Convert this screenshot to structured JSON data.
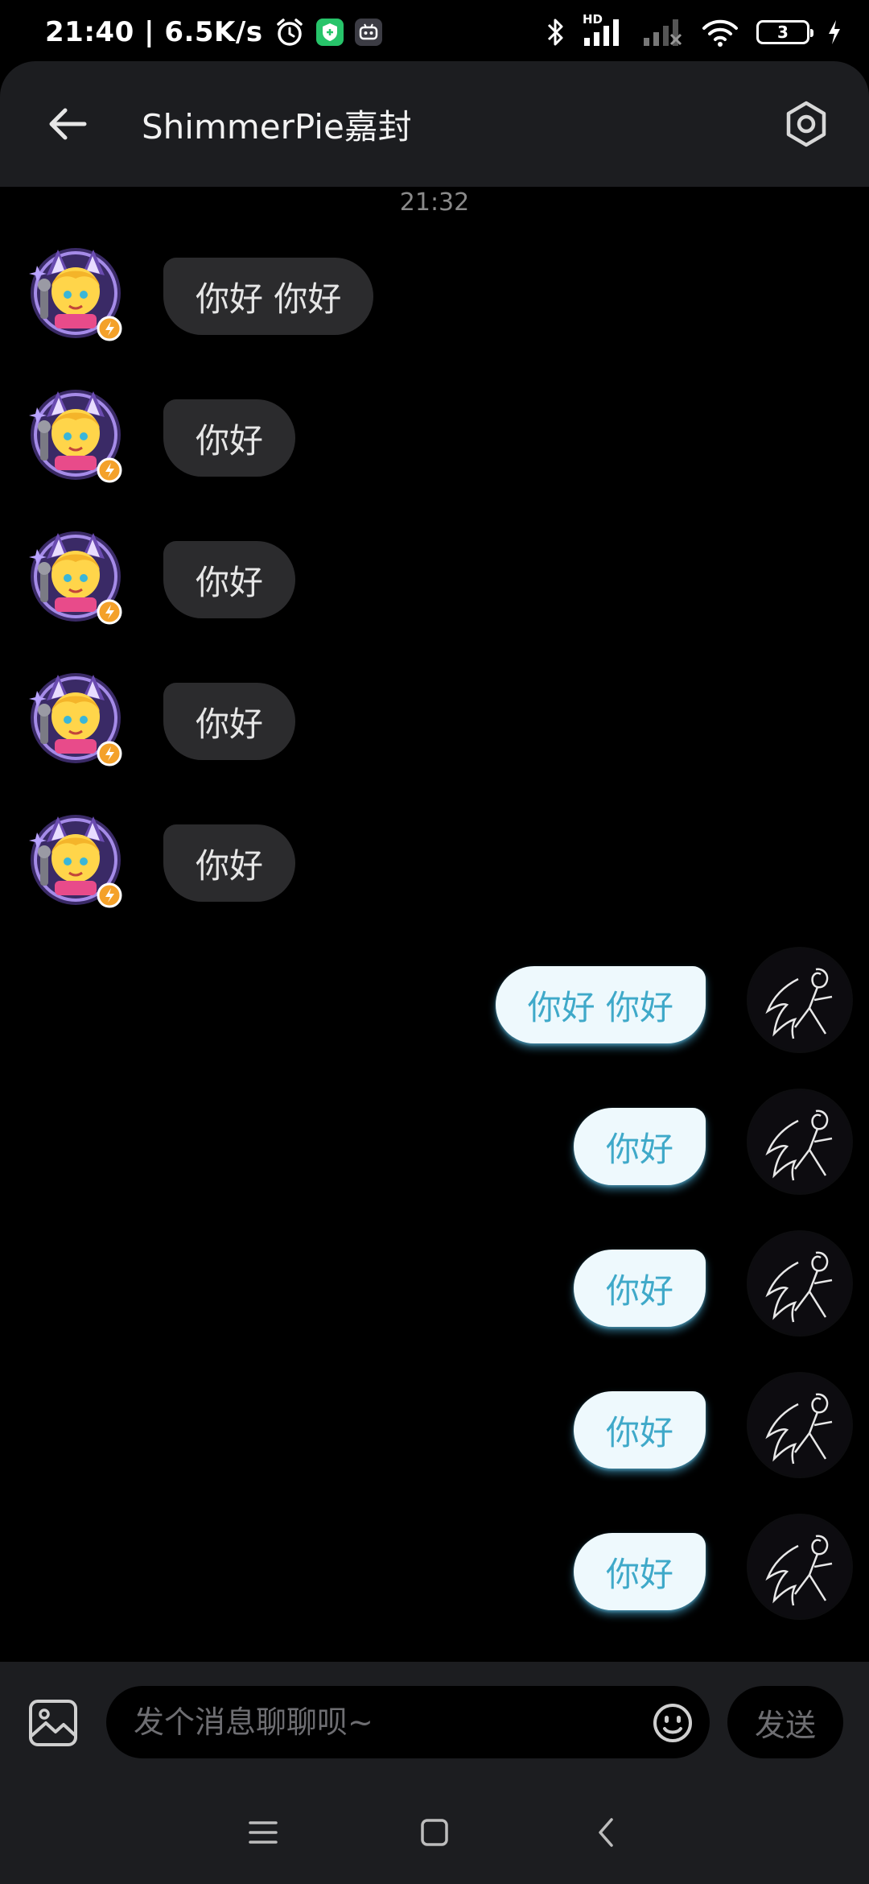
{
  "status_bar": {
    "time_speed": "21:40 | 6.5K/s",
    "network_label": "HD",
    "battery_level": "3",
    "icons": [
      "alarm-icon",
      "shield-app-icon",
      "robot-app-icon",
      "bluetooth-icon",
      "signal-icon",
      "signal-weak-icon",
      "wifi-icon",
      "battery-icon",
      "charging-icon"
    ]
  },
  "header": {
    "title": "ShimmerPie嘉封",
    "back_icon": "arrow-left-icon",
    "settings_icon": "hexagon-settings-icon"
  },
  "chat": {
    "timestamp": "21:32",
    "messages": [
      {
        "side": "left",
        "text": "你好 你好"
      },
      {
        "side": "left",
        "text": "你好"
      },
      {
        "side": "left",
        "text": "你好"
      },
      {
        "side": "left",
        "text": "你好"
      },
      {
        "side": "left",
        "text": "你好"
      },
      {
        "side": "right",
        "text": "你好 你好"
      },
      {
        "side": "right",
        "text": "你好"
      },
      {
        "side": "right",
        "text": "你好"
      },
      {
        "side": "right",
        "text": "你好"
      },
      {
        "side": "right",
        "text": "你好"
      }
    ]
  },
  "input": {
    "placeholder": "发个消息聊聊呗~",
    "value": "",
    "send_label": "发送",
    "image_icon": "image-icon",
    "emoji_icon": "emoji-icon"
  },
  "nav": {
    "icons": [
      "menu-icon",
      "home-square-icon",
      "back-chevron-icon"
    ]
  },
  "colors": {
    "background": "#000000",
    "header_bg": "#1c1d20",
    "incoming_bubble": "#2b2b2d",
    "outgoing_bubble": "#eef9fd",
    "outgoing_text": "#3fa9c9"
  }
}
